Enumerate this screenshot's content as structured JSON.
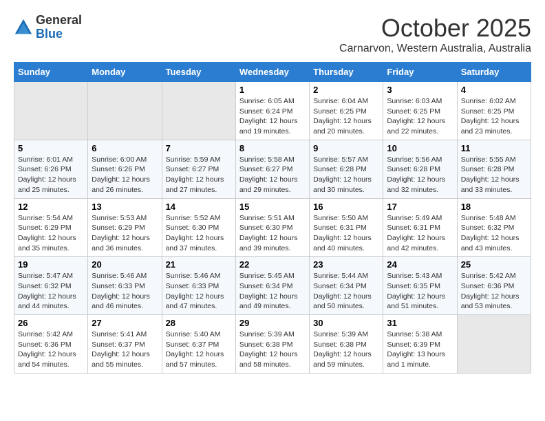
{
  "logo": {
    "general": "General",
    "blue": "Blue"
  },
  "header": {
    "month": "October 2025",
    "subtitle": "Carnarvon, Western Australia, Australia"
  },
  "days_of_week": [
    "Sunday",
    "Monday",
    "Tuesday",
    "Wednesday",
    "Thursday",
    "Friday",
    "Saturday"
  ],
  "weeks": [
    [
      {
        "day": "",
        "content": ""
      },
      {
        "day": "",
        "content": ""
      },
      {
        "day": "",
        "content": ""
      },
      {
        "day": "1",
        "content": "Sunrise: 6:05 AM\nSunset: 6:24 PM\nDaylight: 12 hours and 19 minutes."
      },
      {
        "day": "2",
        "content": "Sunrise: 6:04 AM\nSunset: 6:25 PM\nDaylight: 12 hours and 20 minutes."
      },
      {
        "day": "3",
        "content": "Sunrise: 6:03 AM\nSunset: 6:25 PM\nDaylight: 12 hours and 22 minutes."
      },
      {
        "day": "4",
        "content": "Sunrise: 6:02 AM\nSunset: 6:25 PM\nDaylight: 12 hours and 23 minutes."
      }
    ],
    [
      {
        "day": "5",
        "content": "Sunrise: 6:01 AM\nSunset: 6:26 PM\nDaylight: 12 hours and 25 minutes."
      },
      {
        "day": "6",
        "content": "Sunrise: 6:00 AM\nSunset: 6:26 PM\nDaylight: 12 hours and 26 minutes."
      },
      {
        "day": "7",
        "content": "Sunrise: 5:59 AM\nSunset: 6:27 PM\nDaylight: 12 hours and 27 minutes."
      },
      {
        "day": "8",
        "content": "Sunrise: 5:58 AM\nSunset: 6:27 PM\nDaylight: 12 hours and 29 minutes."
      },
      {
        "day": "9",
        "content": "Sunrise: 5:57 AM\nSunset: 6:28 PM\nDaylight: 12 hours and 30 minutes."
      },
      {
        "day": "10",
        "content": "Sunrise: 5:56 AM\nSunset: 6:28 PM\nDaylight: 12 hours and 32 minutes."
      },
      {
        "day": "11",
        "content": "Sunrise: 5:55 AM\nSunset: 6:28 PM\nDaylight: 12 hours and 33 minutes."
      }
    ],
    [
      {
        "day": "12",
        "content": "Sunrise: 5:54 AM\nSunset: 6:29 PM\nDaylight: 12 hours and 35 minutes."
      },
      {
        "day": "13",
        "content": "Sunrise: 5:53 AM\nSunset: 6:29 PM\nDaylight: 12 hours and 36 minutes."
      },
      {
        "day": "14",
        "content": "Sunrise: 5:52 AM\nSunset: 6:30 PM\nDaylight: 12 hours and 37 minutes."
      },
      {
        "day": "15",
        "content": "Sunrise: 5:51 AM\nSunset: 6:30 PM\nDaylight: 12 hours and 39 minutes."
      },
      {
        "day": "16",
        "content": "Sunrise: 5:50 AM\nSunset: 6:31 PM\nDaylight: 12 hours and 40 minutes."
      },
      {
        "day": "17",
        "content": "Sunrise: 5:49 AM\nSunset: 6:31 PM\nDaylight: 12 hours and 42 minutes."
      },
      {
        "day": "18",
        "content": "Sunrise: 5:48 AM\nSunset: 6:32 PM\nDaylight: 12 hours and 43 minutes."
      }
    ],
    [
      {
        "day": "19",
        "content": "Sunrise: 5:47 AM\nSunset: 6:32 PM\nDaylight: 12 hours and 44 minutes."
      },
      {
        "day": "20",
        "content": "Sunrise: 5:46 AM\nSunset: 6:33 PM\nDaylight: 12 hours and 46 minutes."
      },
      {
        "day": "21",
        "content": "Sunrise: 5:46 AM\nSunset: 6:33 PM\nDaylight: 12 hours and 47 minutes."
      },
      {
        "day": "22",
        "content": "Sunrise: 5:45 AM\nSunset: 6:34 PM\nDaylight: 12 hours and 49 minutes."
      },
      {
        "day": "23",
        "content": "Sunrise: 5:44 AM\nSunset: 6:34 PM\nDaylight: 12 hours and 50 minutes."
      },
      {
        "day": "24",
        "content": "Sunrise: 5:43 AM\nSunset: 6:35 PM\nDaylight: 12 hours and 51 minutes."
      },
      {
        "day": "25",
        "content": "Sunrise: 5:42 AM\nSunset: 6:36 PM\nDaylight: 12 hours and 53 minutes."
      }
    ],
    [
      {
        "day": "26",
        "content": "Sunrise: 5:42 AM\nSunset: 6:36 PM\nDaylight: 12 hours and 54 minutes."
      },
      {
        "day": "27",
        "content": "Sunrise: 5:41 AM\nSunset: 6:37 PM\nDaylight: 12 hours and 55 minutes."
      },
      {
        "day": "28",
        "content": "Sunrise: 5:40 AM\nSunset: 6:37 PM\nDaylight: 12 hours and 57 minutes."
      },
      {
        "day": "29",
        "content": "Sunrise: 5:39 AM\nSunset: 6:38 PM\nDaylight: 12 hours and 58 minutes."
      },
      {
        "day": "30",
        "content": "Sunrise: 5:39 AM\nSunset: 6:38 PM\nDaylight: 12 hours and 59 minutes."
      },
      {
        "day": "31",
        "content": "Sunrise: 5:38 AM\nSunset: 6:39 PM\nDaylight: 13 hours and 1 minute."
      },
      {
        "day": "",
        "content": ""
      }
    ]
  ]
}
